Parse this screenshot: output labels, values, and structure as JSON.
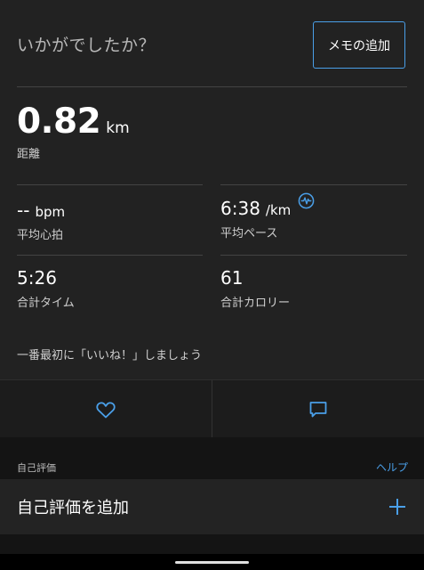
{
  "header": {
    "question": "いかがでしたか？",
    "memo_button": "メモの追加"
  },
  "distance": {
    "value": "0.82",
    "unit": "km",
    "label": "距離"
  },
  "stats": {
    "heart_rate": {
      "value": "--",
      "unit": "bpm",
      "label": "平均心拍"
    },
    "pace": {
      "value": "6:38",
      "unit": "/km",
      "label": "平均ペース",
      "icon": "pace-info-icon"
    },
    "total_time": {
      "value": "5:26",
      "label": "合計タイム"
    },
    "calories": {
      "value": "61",
      "label": "合計カロリー"
    }
  },
  "social": {
    "like_prompt": "一番最初に「いいね！」しましょう",
    "like_icon": "heart-icon",
    "comment_icon": "comment-icon"
  },
  "self_evaluation": {
    "section_title": "自己評価",
    "help_link": "ヘルプ",
    "add_label": "自己評価を追加",
    "add_icon": "plus-icon"
  },
  "colors": {
    "accent": "#4a9fe8",
    "background": "#222222"
  }
}
